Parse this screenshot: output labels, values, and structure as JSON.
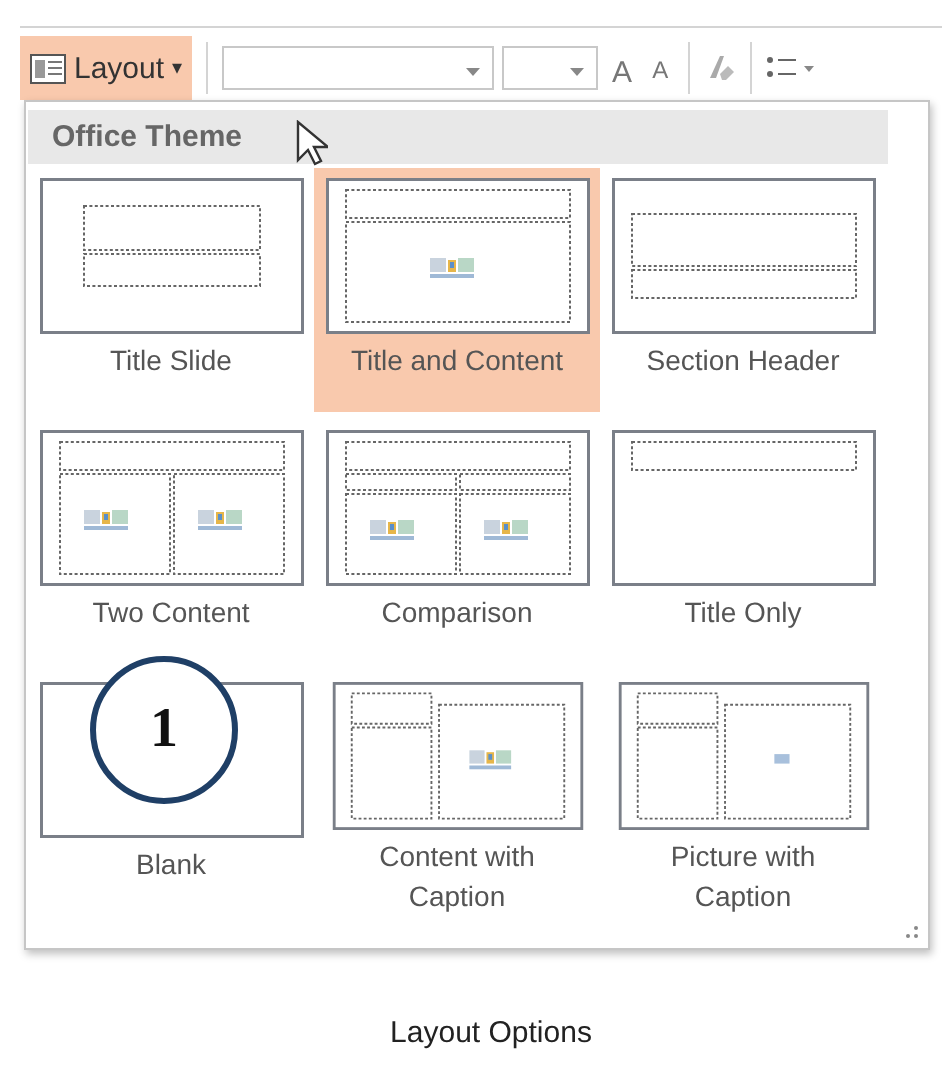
{
  "toolbar": {
    "layout_button": {
      "label": "Layout",
      "caret": "▾",
      "selected": true
    },
    "font_buttons": [
      {
        "label": "A",
        "kind": "grow"
      },
      {
        "label": "A",
        "kind": "shrink"
      }
    ]
  },
  "gallery": {
    "header": "Office Theme",
    "layouts": [
      {
        "label": "Title Slide",
        "kind": "title-slide",
        "selected": false
      },
      {
        "label": "Title and Content",
        "kind": "title-content",
        "selected": true
      },
      {
        "label": "Section Header",
        "kind": "section-header",
        "selected": false
      },
      {
        "label": "Two Content",
        "kind": "two-content",
        "selected": false
      },
      {
        "label": "Comparison",
        "kind": "comparison",
        "selected": false
      },
      {
        "label": "Title Only",
        "kind": "title-only",
        "selected": false
      },
      {
        "label": "Blank",
        "kind": "blank",
        "selected": false
      },
      {
        "label": "Content with Caption",
        "kind": "content-caption",
        "selected": false
      },
      {
        "label": "Picture with Caption",
        "kind": "picture-caption",
        "selected": false
      }
    ]
  },
  "callout": "1",
  "caption": "Layout Options"
}
